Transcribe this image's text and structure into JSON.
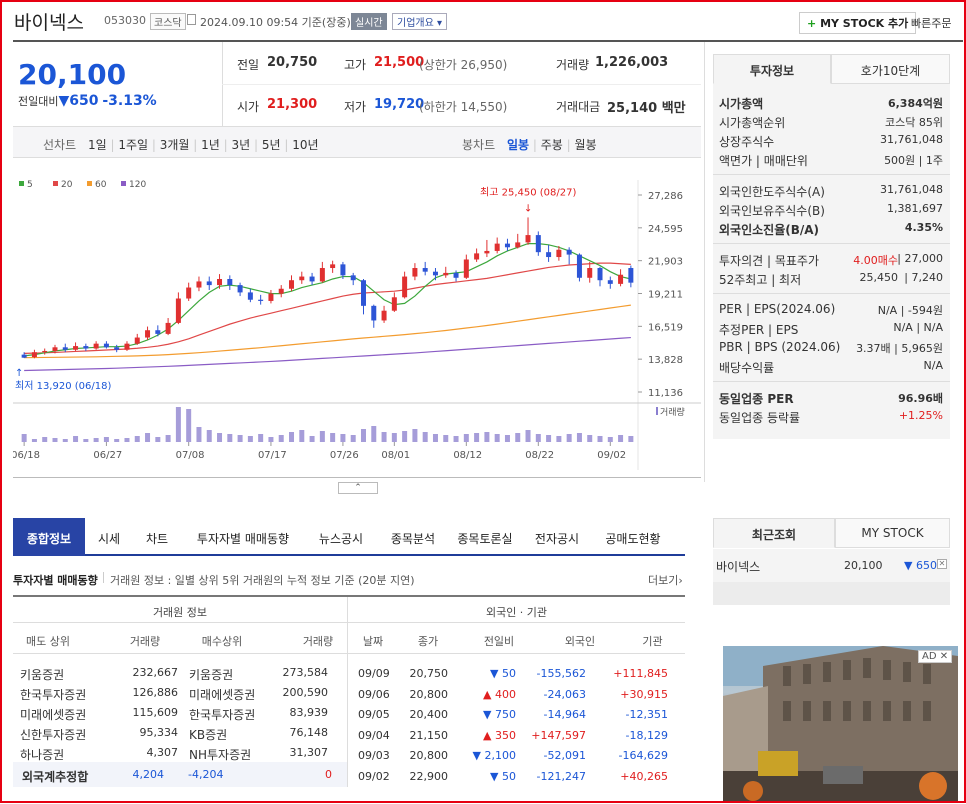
{
  "header": {
    "stock_name": "바이넥스",
    "code": "053030",
    "market": "코스닥",
    "datetime": "2024.09.10 09:54 기준(장중)",
    "realtime": "실시간",
    "company_info": "기업개요",
    "mystock_add": "MY STOCK 추가",
    "fast_order": "빠른주문"
  },
  "quote": {
    "price": "20,100",
    "change_label": "전일대비",
    "change": "650",
    "change_pct": "-3.13%",
    "prev_close_label": "전일",
    "prev_close": "20,750",
    "high_label": "고가",
    "high": "21,500",
    "upper_limit": "(상한가 26,950)",
    "volume_label": "거래량",
    "volume": "1,226,003",
    "open_label": "시가",
    "open": "21,300",
    "low_label": "저가",
    "low": "19,720",
    "lower_limit": "(하한가 14,550)",
    "amount_label": "거래대금",
    "amount": "25,140 백만"
  },
  "chart_controls": {
    "line_label": "선차트",
    "periods": [
      "1일",
      "1주일",
      "3개월",
      "1년",
      "3년",
      "5년",
      "10년"
    ],
    "bar_label": "봉차트",
    "bar_periods": [
      "일봉",
      "주봉",
      "월봉"
    ]
  },
  "chart_data": {
    "type": "candlestick",
    "legend": [
      "5",
      "20",
      "60",
      "120"
    ],
    "legend_colors": [
      "#3da83d",
      "#e04848",
      "#f39c2f",
      "#8a5cc5"
    ],
    "y_ticks": [
      "27,286",
      "24,595",
      "21,903",
      "19,211",
      "16,519",
      "13,828",
      "11,136"
    ],
    "ylim": [
      11136,
      27286
    ],
    "x_ticks": [
      "06/18",
      "06/27",
      "07/08",
      "07/17",
      "07/26",
      "08/01",
      "08/12",
      "08/22",
      "09/02"
    ],
    "high_annot": "최고 25,450 (08/27)",
    "low_annot": "최저 13,920 (06/18)",
    "volume_legend": "거래량",
    "candles": [
      [
        14200,
        13950,
        14400,
        13920
      ],
      [
        14000,
        14400,
        14600,
        13900
      ],
      [
        14400,
        14500,
        14700,
        14200
      ],
      [
        14500,
        14800,
        15000,
        14300
      ],
      [
        14800,
        14600,
        15100,
        14400
      ],
      [
        14600,
        14900,
        15200,
        14500
      ],
      [
        14900,
        14700,
        15100,
        14500
      ],
      [
        14700,
        15100,
        15300,
        14600
      ],
      [
        15100,
        14800,
        15300,
        14700
      ],
      [
        14800,
        14600,
        15000,
        14400
      ],
      [
        14600,
        15100,
        15300,
        14500
      ],
      [
        15100,
        15600,
        15900,
        15000
      ],
      [
        15600,
        16200,
        16500,
        15400
      ],
      [
        16200,
        15900,
        16600,
        15700
      ],
      [
        15900,
        16800,
        17200,
        15800
      ],
      [
        16800,
        18800,
        19300,
        16700
      ],
      [
        18800,
        19700,
        20100,
        18600
      ],
      [
        19700,
        20200,
        20600,
        19400
      ],
      [
        20200,
        19900,
        20600,
        19500
      ],
      [
        19900,
        20400,
        20800,
        19600
      ],
      [
        20400,
        19900,
        20700,
        19500
      ],
      [
        19900,
        19300,
        20100,
        19000
      ],
      [
        19300,
        18700,
        19600,
        18500
      ],
      [
        18700,
        18600,
        19100,
        18300
      ],
      [
        18600,
        19200,
        19500,
        18400
      ],
      [
        19200,
        19600,
        19900,
        18900
      ],
      [
        19600,
        20300,
        20700,
        19400
      ],
      [
        20300,
        20600,
        21000,
        20000
      ],
      [
        20600,
        20200,
        20900,
        19900
      ],
      [
        20200,
        21300,
        21800,
        20100
      ],
      [
        21300,
        21600,
        21900,
        20900
      ],
      [
        21600,
        20700,
        21800,
        20400
      ],
      [
        20700,
        20300,
        20900,
        19900
      ],
      [
        20300,
        18200,
        20400,
        17500
      ],
      [
        18200,
        17000,
        18300,
        16400
      ],
      [
        17000,
        17800,
        18200,
        16800
      ],
      [
        17800,
        18900,
        19300,
        17700
      ],
      [
        18900,
        20600,
        21000,
        18800
      ],
      [
        20600,
        21300,
        21700,
        20300
      ],
      [
        21300,
        21000,
        21800,
        20700
      ],
      [
        21000,
        20700,
        21300,
        20300
      ],
      [
        20700,
        20900,
        21400,
        20500
      ],
      [
        20900,
        20500,
        21100,
        20200
      ],
      [
        20500,
        22000,
        22400,
        20400
      ],
      [
        22000,
        22500,
        22900,
        21800
      ],
      [
        22500,
        22700,
        23600,
        22200
      ],
      [
        22700,
        23300,
        23800,
        22500
      ],
      [
        23300,
        23000,
        23700,
        22700
      ],
      [
        23000,
        23400,
        24100,
        22900
      ],
      [
        23400,
        24000,
        25450,
        23200
      ],
      [
        24000,
        22600,
        24300,
        22300
      ],
      [
        22600,
        22200,
        23200,
        21800
      ],
      [
        22200,
        22800,
        23100,
        21900
      ],
      [
        22800,
        22400,
        23000,
        21600
      ],
      [
        22400,
        20500,
        22500,
        20200
      ],
      [
        20500,
        21300,
        21800,
        20100
      ],
      [
        21300,
        20300,
        21400,
        19800
      ],
      [
        20300,
        20000,
        20600,
        19600
      ],
      [
        20000,
        20750,
        21200,
        19800
      ],
      [
        21300,
        20100,
        21500,
        19720
      ]
    ],
    "ma5": [
      14100,
      14200,
      14350,
      14500,
      14600,
      14700,
      14750,
      14800,
      14850,
      14850,
      14900,
      15100,
      15400,
      15800,
      16300,
      17000,
      17800,
      18600,
      19300,
      19800,
      19900,
      19800,
      19600,
      19400,
      19200,
      19200,
      19400,
      19700,
      19900,
      20100,
      20400,
      20600,
      20600,
      20100,
      19400,
      18700,
      18300,
      18400,
      19000,
      19800,
      20500,
      20800,
      20900,
      21000,
      21400,
      21800,
      22300,
      22700,
      23000,
      23300,
      23300,
      23200,
      23000,
      22700,
      22300,
      21900,
      21500,
      21000,
      20600,
      20400
    ],
    "ma20": [
      14300,
      14320,
      14350,
      14380,
      14420,
      14460,
      14500,
      14540,
      14580,
      14620,
      14660,
      14720,
      14800,
      14900,
      15050,
      15250,
      15500,
      15800,
      16100,
      16400,
      16700,
      16950,
      17200,
      17400,
      17600,
      17800,
      18000,
      18200,
      18400,
      18600,
      18800,
      19000,
      19150,
      19250,
      19300,
      19350,
      19400,
      19500,
      19650,
      19800,
      19950,
      20050,
      20150,
      20250,
      20350,
      20450,
      20600,
      20750,
      20900,
      21050,
      21200,
      21350,
      21450,
      21550,
      21600,
      21650,
      21700,
      21700,
      21650,
      21600
    ],
    "ma60": [
      13950,
      13960,
      13970,
      13980,
      13990,
      14000,
      14010,
      14020,
      14040,
      14060,
      14080,
      14100,
      14130,
      14160,
      14200,
      14250,
      14300,
      14360,
      14420,
      14490,
      14560,
      14630,
      14700,
      14770,
      14850,
      14930,
      15010,
      15090,
      15170,
      15250,
      15330,
      15410,
      15490,
      15560,
      15630,
      15700,
      15770,
      15840,
      15920,
      16000,
      16090,
      16180,
      16280,
      16380,
      16480,
      16590,
      16700,
      16820,
      16940,
      17060,
      17180,
      17300,
      17420,
      17540,
      17660,
      17780,
      17900,
      18020,
      18140,
      18260
    ],
    "ma120": [
      12900,
      12920,
      12940,
      12960,
      12980,
      13000,
      13020,
      13040,
      13060,
      13090,
      13120,
      13150,
      13180,
      13210,
      13240,
      13280,
      13320,
      13360,
      13400,
      13440,
      13480,
      13520,
      13560,
      13600,
      13640,
      13690,
      13740,
      13790,
      13840,
      13890,
      13940,
      13990,
      14040,
      14090,
      14140,
      14190,
      14240,
      14290,
      14340,
      14400,
      14460,
      14520,
      14580,
      14640,
      14700,
      14760,
      14820,
      14880,
      14940,
      15000,
      15060,
      15120,
      15180,
      15240,
      15300,
      15360,
      15420,
      15480,
      15540,
      15600
    ],
    "volumes": [
      8,
      3,
      5,
      4,
      3,
      6,
      3,
      4,
      5,
      3,
      4,
      6,
      9,
      5,
      7,
      35,
      33,
      15,
      12,
      9,
      8,
      7,
      6,
      8,
      5,
      7,
      10,
      12,
      6,
      11,
      9,
      8,
      7,
      13,
      16,
      10,
      9,
      11,
      13,
      10,
      8,
      7,
      6,
      8,
      9,
      10,
      8,
      7,
      9,
      12,
      8,
      7,
      6,
      8,
      9,
      7,
      6,
      5,
      7,
      6
    ]
  },
  "side_panel": {
    "tab1": "투자정보",
    "tab2": "호가10단계",
    "rows1": [
      {
        "k": "시가총액",
        "v": "6,384억원"
      },
      {
        "k": "시가총액순위",
        "v": "코스닥 85위"
      },
      {
        "k": "상장주식수",
        "v": "31,761,048"
      },
      {
        "k": "액면가 | 매매단위",
        "v": "500원 | 1주"
      }
    ],
    "rows2": [
      {
        "k": "외국인한도주식수(A)",
        "v": "31,761,048"
      },
      {
        "k": "외국인보유주식수(B)",
        "v": "1,381,697"
      },
      {
        "k": "외국인소진율(B/A)",
        "v": "4.35%"
      }
    ],
    "rows3": [
      {
        "k": "투자의견 | 목표주가",
        "v1": "4.00매수",
        "v2": "| 27,000"
      },
      {
        "k": "52주최고 | 최저",
        "v1": "25,450",
        "v2": "| 7,240"
      }
    ],
    "rows4": [
      {
        "k": "PER | EPS(2024.06)",
        "v": "N/A | -594원"
      },
      {
        "k": "추정PER | EPS",
        "v": "N/A | N/A"
      },
      {
        "k": "PBR | BPS (2024.06)",
        "v": "3.37배 | 5,965원"
      },
      {
        "k": "배당수익률",
        "v": "N/A"
      }
    ],
    "rows5": [
      {
        "k": "동일업종 PER",
        "v": "96.96배"
      },
      {
        "k": "동일업종 등락률",
        "v": "+1.25%"
      }
    ]
  },
  "recent": {
    "tab1": "최근조회",
    "tab2": "MY STOCK",
    "name": "바이넥스",
    "price": "20,100",
    "change": "650"
  },
  "ad": {
    "label": "AD"
  },
  "bottom_tabs": [
    "종합정보",
    "시세",
    "차트",
    "투자자별 매매동향",
    "뉴스공시",
    "종목분석",
    "종목토론실",
    "전자공시",
    "공매도현황"
  ],
  "investor": {
    "title": "투자자별 매매동향",
    "desc": "거래원 정보 : 일별 상위 5위 거래원의 누적 정보 기준 (20분 지연)",
    "more": "더보기",
    "broker_header": "거래원 정보",
    "foreign_header": "외국인 · 기관",
    "cols": [
      "매도 상위",
      "거래량",
      "매수상위",
      "거래량",
      "날짜",
      "종가",
      "전일비",
      "외국인",
      "기관"
    ],
    "brokers": [
      [
        "키움증권",
        "232,667",
        "키움증권",
        "273,584"
      ],
      [
        "한국투자증권",
        "126,886",
        "미래에셋증권",
        "200,590"
      ],
      [
        "미래에셋증권",
        "115,609",
        "한국투자증권",
        "83,939"
      ],
      [
        "신한투자증권",
        "95,334",
        "KB증권",
        "76,148"
      ],
      [
        "하나증권",
        "4,307",
        "NH투자증권",
        "31,307"
      ]
    ],
    "foreign_sum": [
      "외국계추정합",
      "4,204",
      "-4,204",
      "0"
    ],
    "daily": [
      [
        "09/09",
        "20,750",
        "▼ 50",
        "-155,562",
        "+111,845"
      ],
      [
        "09/06",
        "20,800",
        "▲ 400",
        "-24,063",
        "+30,915"
      ],
      [
        "09/05",
        "20,400",
        "▼ 750",
        "-14,964",
        "-12,351"
      ],
      [
        "09/04",
        "21,150",
        "▲ 350",
        "+147,597",
        "-18,129"
      ],
      [
        "09/03",
        "20,800",
        "▼ 2,100",
        "-52,091",
        "-164,629"
      ],
      [
        "09/02",
        "22,900",
        "▼ 50",
        "-121,247",
        "+40,265"
      ]
    ]
  }
}
